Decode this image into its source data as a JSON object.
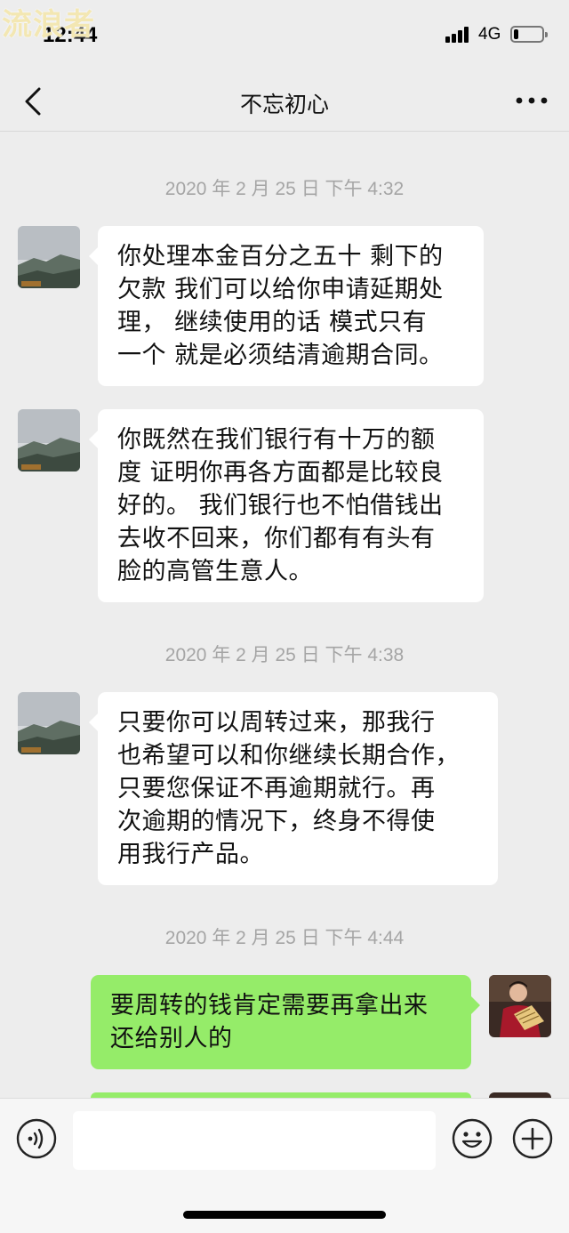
{
  "watermark": "流浪者",
  "status": {
    "time": "12:44",
    "network": "4G",
    "battery_level": 0.1
  },
  "nav": {
    "title": "不忘初心"
  },
  "icons": {
    "back": "chevron-left-icon",
    "more": "more-dots-icon",
    "voice": "voice-icon",
    "emoji": "emoji-icon",
    "plus": "plus-icon"
  },
  "colors": {
    "outgoing_bubble": "#95ec69",
    "incoming_bubble": "#ffffff",
    "background": "#ededed"
  },
  "timestamps": [
    "2020 年 2 月 25 日 下午 4:32",
    "2020 年 2 月 25 日 下午 4:38",
    "2020 年 2 月 25 日 下午 4:44"
  ],
  "messages": [
    {
      "direction": "in",
      "lines": [
        "你处理本金百分之五十 剩下的",
        "欠款 我们可以给你申请延期处",
        "理，  继续使用的话 模式只有",
        "一个 就是必须结清逾期合同。"
      ]
    },
    {
      "direction": "in",
      "lines": [
        "你既然在我们银行有十万的额",
        "度 证明你再各方面都是比较良",
        "好的。 我们银行也不怕借钱出",
        "去收不回来，你们都有有头有",
        "脸的高管生意人。"
      ]
    },
    {
      "direction": "in",
      "lines": [
        "只要你可以周转过来，那我行",
        "也希望可以和你继续长期合作，",
        "只要您保证不再逾期就行。再",
        "次逾期的情况下，终身不得使",
        "用我行产品。"
      ]
    },
    {
      "direction": "out",
      "lines": [
        "要周转的钱肯定需要再拿出来",
        "还给别人的"
      ]
    }
  ],
  "input": {
    "value": "",
    "placeholder": ""
  }
}
